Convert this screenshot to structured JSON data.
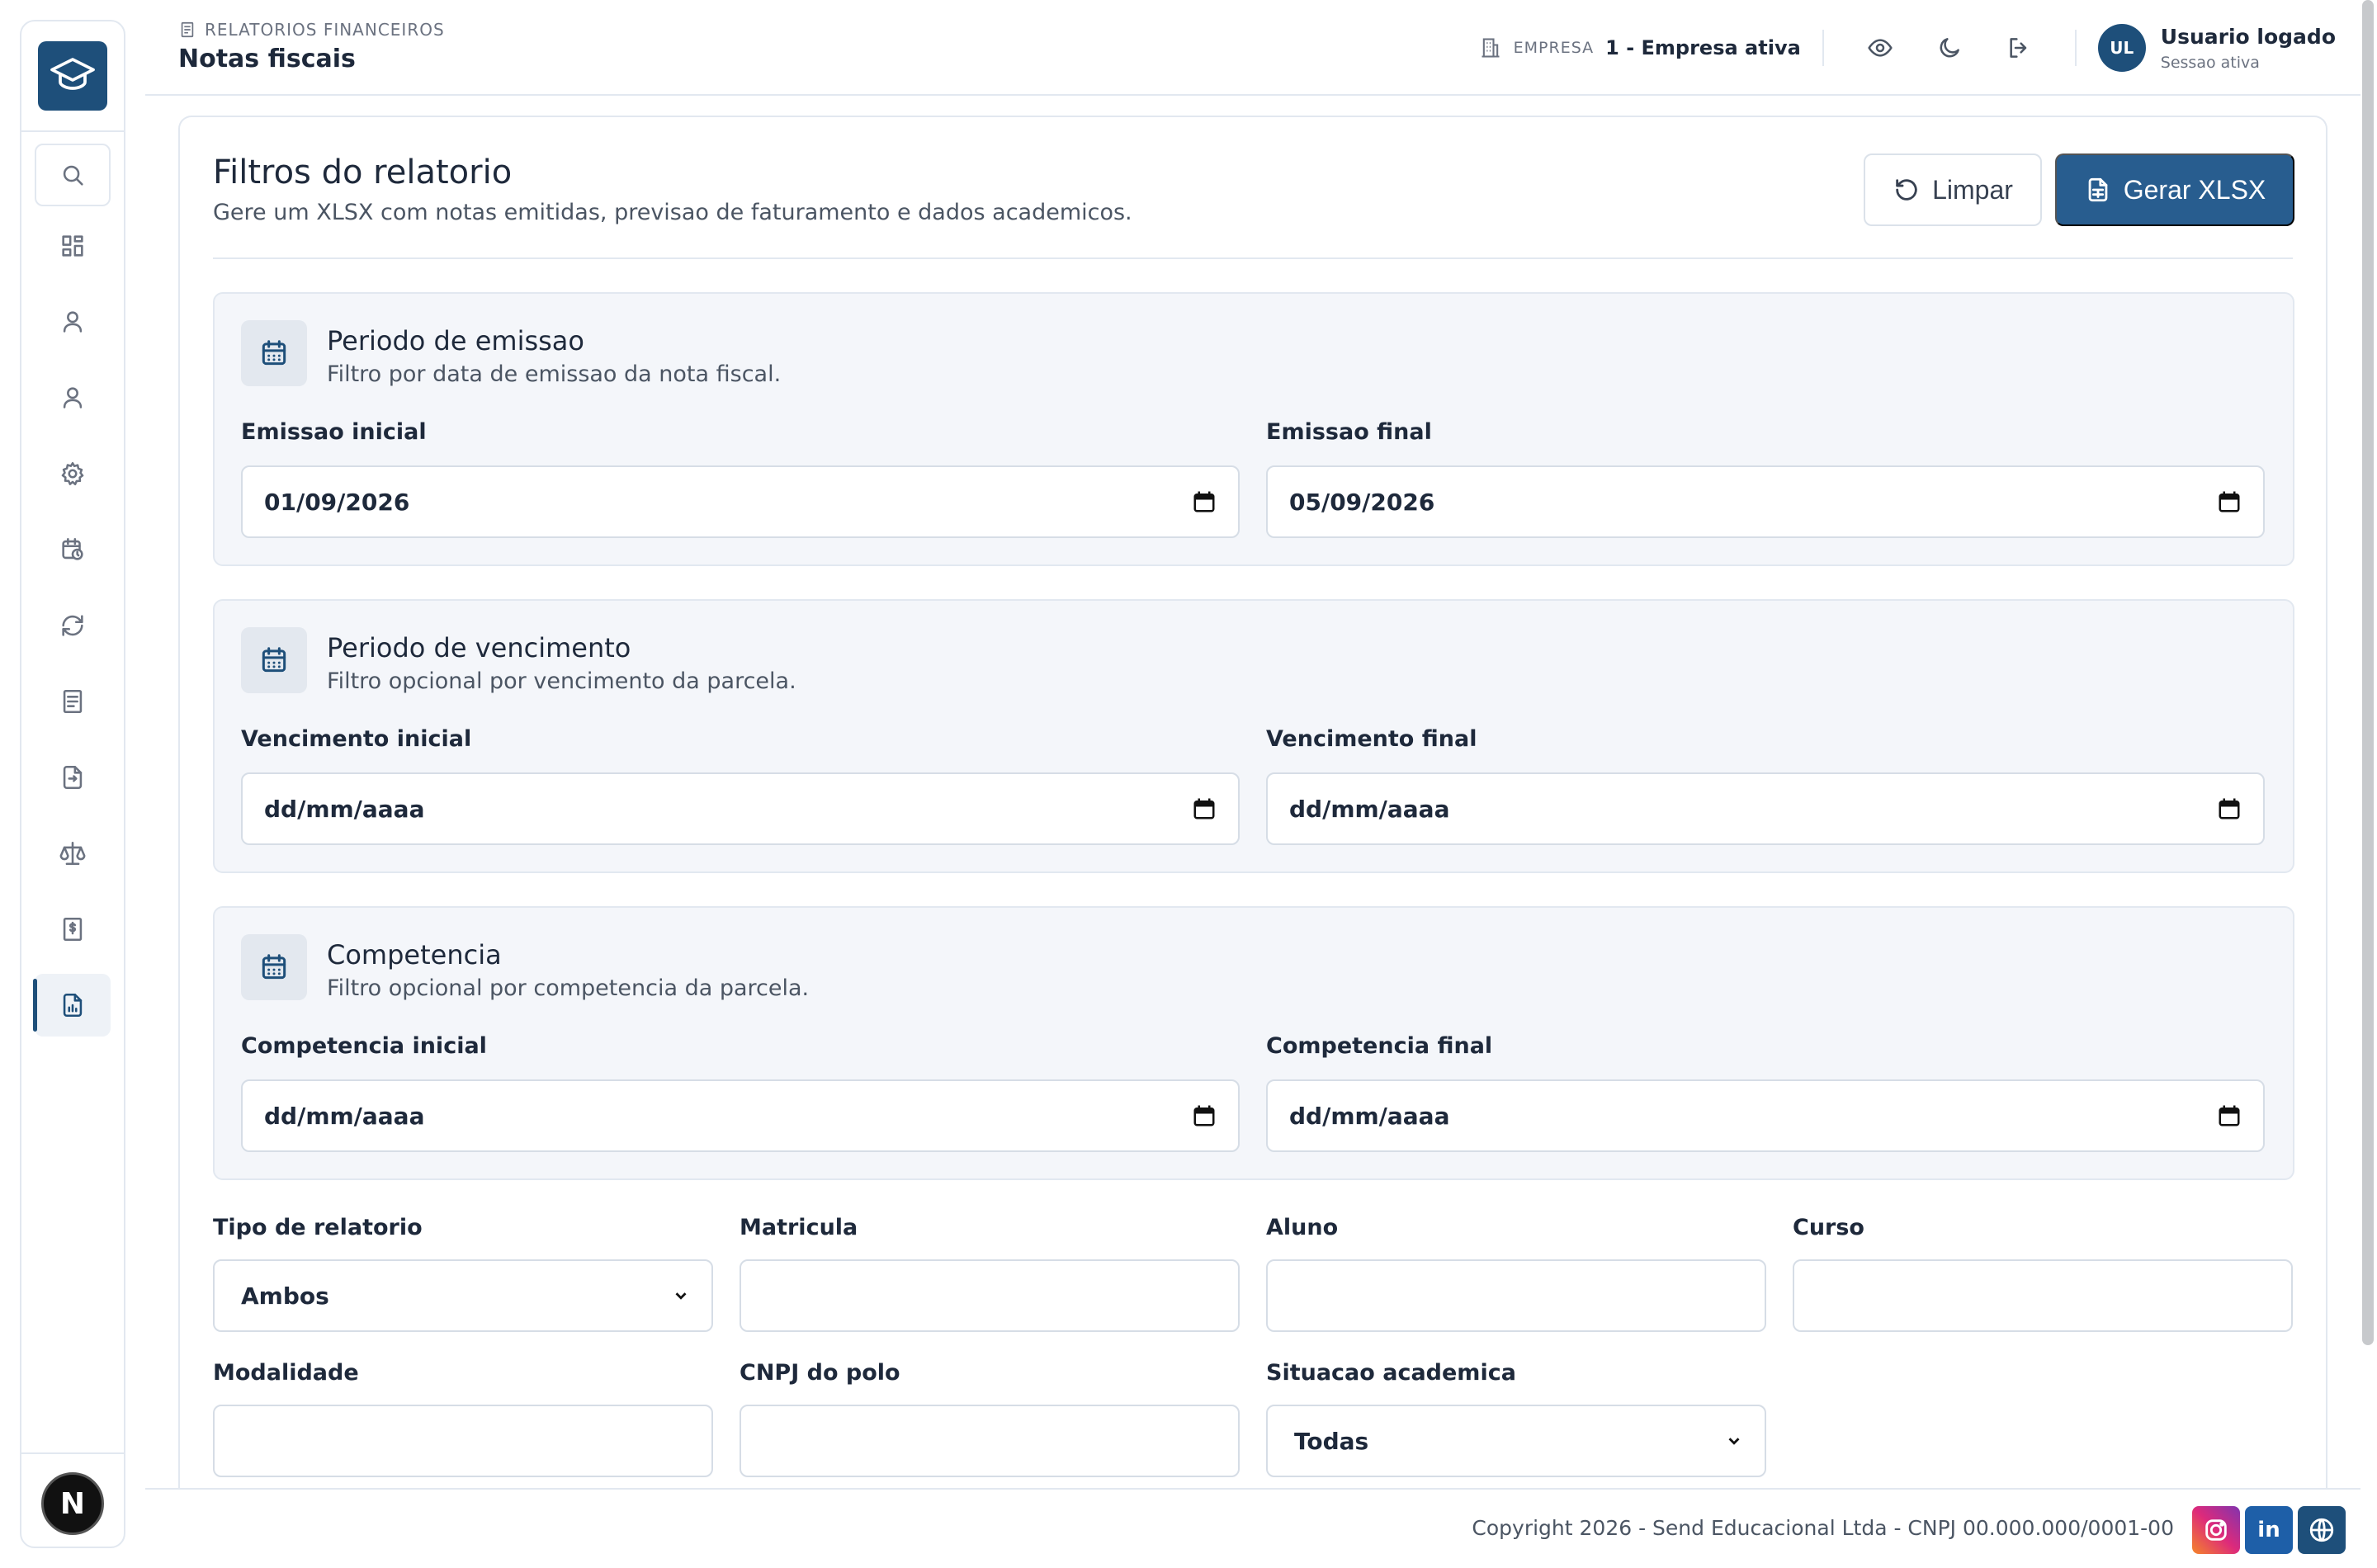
{
  "breadcrumb": "RELATORIOS FINANCEIROS",
  "page_title": "Notas fiscais",
  "header": {
    "company_label": "EMPRESA",
    "company_value": "1 - Empresa ativa",
    "user_initials": "UL",
    "user_name": "Usuario logado",
    "user_status": "Sessao ativa"
  },
  "sidebar": {
    "items": [
      "search-icon",
      "dashboard-icon",
      "user-icon",
      "user-icon",
      "gear-icon",
      "calendar-clock-icon",
      "refresh-icon",
      "document-icon",
      "file-transfer-icon",
      "scale-icon",
      "dollar-document-icon",
      "report-chart-icon"
    ],
    "active_index": 11,
    "footer_logo": "N"
  },
  "card": {
    "title": "Filtros do relatorio",
    "subtitle": "Gere um XLSX com notas emitidas, previsao de faturamento e dados academicos.",
    "clear_label": "Limpar",
    "generate_label": "Gerar XLSX"
  },
  "sections": {
    "emissao": {
      "title": "Periodo de emissao",
      "subtitle": "Filtro por data de emissao da nota fiscal.",
      "start_label": "Emissao inicial",
      "start_value": "01/09/2026",
      "end_label": "Emissao final",
      "end_value": "05/09/2026"
    },
    "vencimento": {
      "title": "Periodo de vencimento",
      "subtitle": "Filtro opcional por vencimento da parcela.",
      "start_label": "Vencimento inicial",
      "start_value": "dd/mm/aaaa",
      "end_label": "Vencimento final",
      "end_value": "dd/mm/aaaa"
    },
    "competencia": {
      "title": "Competencia",
      "subtitle": "Filtro opcional por competencia da parcela.",
      "start_label": "Competencia inicial",
      "start_value": "dd/mm/aaaa",
      "end_label": "Competencia final",
      "end_value": "dd/mm/aaaa"
    }
  },
  "fields": {
    "tipo_label": "Tipo de relatorio",
    "tipo_value": "Ambos",
    "matricula_label": "Matricula",
    "aluno_label": "Aluno",
    "curso_label": "Curso",
    "modalidade_label": "Modalidade",
    "cnpj_label": "CNPJ do polo",
    "situacao_label": "Situacao academica",
    "situacao_value": "Todas"
  },
  "footer": {
    "copyright": "Copyright 2026 - Send Educacional Ltda - CNPJ 00.000.000/0001-00",
    "linkedin": "in"
  },
  "colors": {
    "primary": "#285d8f",
    "brand": "#1e4f7a",
    "section_bg": "#f4f6fa",
    "border": "#e2e8f0"
  }
}
